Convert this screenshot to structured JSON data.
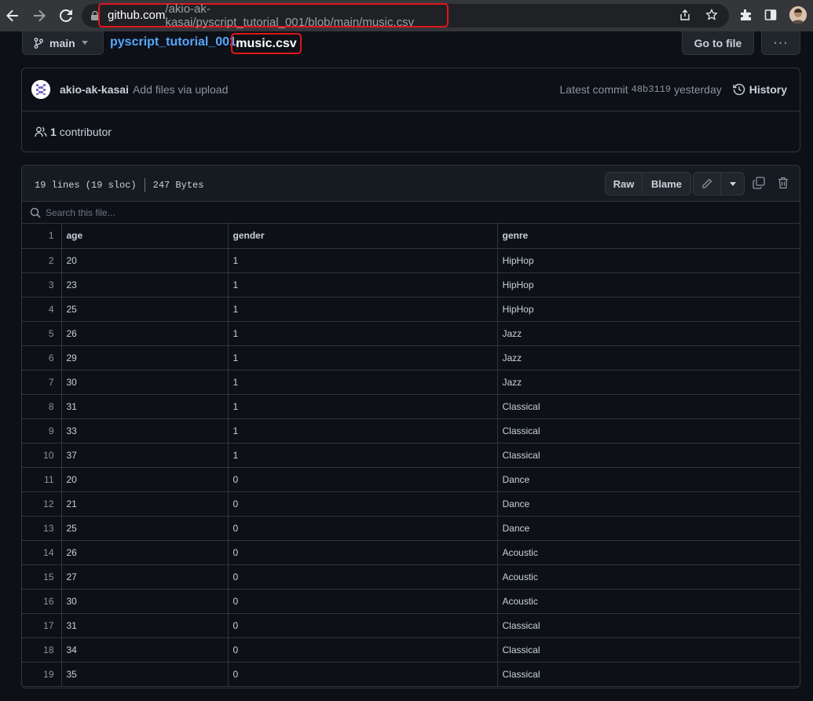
{
  "browser": {
    "url_host": "github.com",
    "url_path": "/akio-ak-kasai/pyscript_tutorial_001/blob/main/music.csv"
  },
  "breadcrumb": {
    "branch": "main",
    "repo": "pyscript_tutorial_001",
    "separator": "/",
    "file": "music.csv",
    "goto_file": "Go to file",
    "more": "···"
  },
  "commit": {
    "author": "akio-ak-kasai",
    "message": "Add files via upload",
    "latest_label": "Latest commit",
    "hash": "48b3119",
    "when": "yesterday",
    "history": "History",
    "contributors_count": "1",
    "contributors_label": "contributor"
  },
  "file": {
    "lines_info": "19 lines (19 sloc)",
    "size": "247 Bytes",
    "raw": "Raw",
    "blame": "Blame",
    "search_placeholder": "Search this file..."
  },
  "table": {
    "header": [
      "age",
      "gender",
      "genre"
    ],
    "rows": [
      [
        "20",
        "1",
        "HipHop"
      ],
      [
        "23",
        "1",
        "HipHop"
      ],
      [
        "25",
        "1",
        "HipHop"
      ],
      [
        "26",
        "1",
        "Jazz"
      ],
      [
        "29",
        "1",
        "Jazz"
      ],
      [
        "30",
        "1",
        "Jazz"
      ],
      [
        "31",
        "1",
        "Classical"
      ],
      [
        "33",
        "1",
        "Classical"
      ],
      [
        "37",
        "1",
        "Classical"
      ],
      [
        "20",
        "0",
        "Dance"
      ],
      [
        "21",
        "0",
        "Dance"
      ],
      [
        "25",
        "0",
        "Dance"
      ],
      [
        "26",
        "0",
        "Acoustic"
      ],
      [
        "27",
        "0",
        "Acoustic"
      ],
      [
        "30",
        "0",
        "Acoustic"
      ],
      [
        "31",
        "0",
        "Classical"
      ],
      [
        "34",
        "0",
        "Classical"
      ],
      [
        "35",
        "0",
        "Classical"
      ]
    ]
  },
  "colors": {
    "background": "#0d1117",
    "accent_link": "#58a6ff",
    "highlight_border": "#e0161e"
  }
}
